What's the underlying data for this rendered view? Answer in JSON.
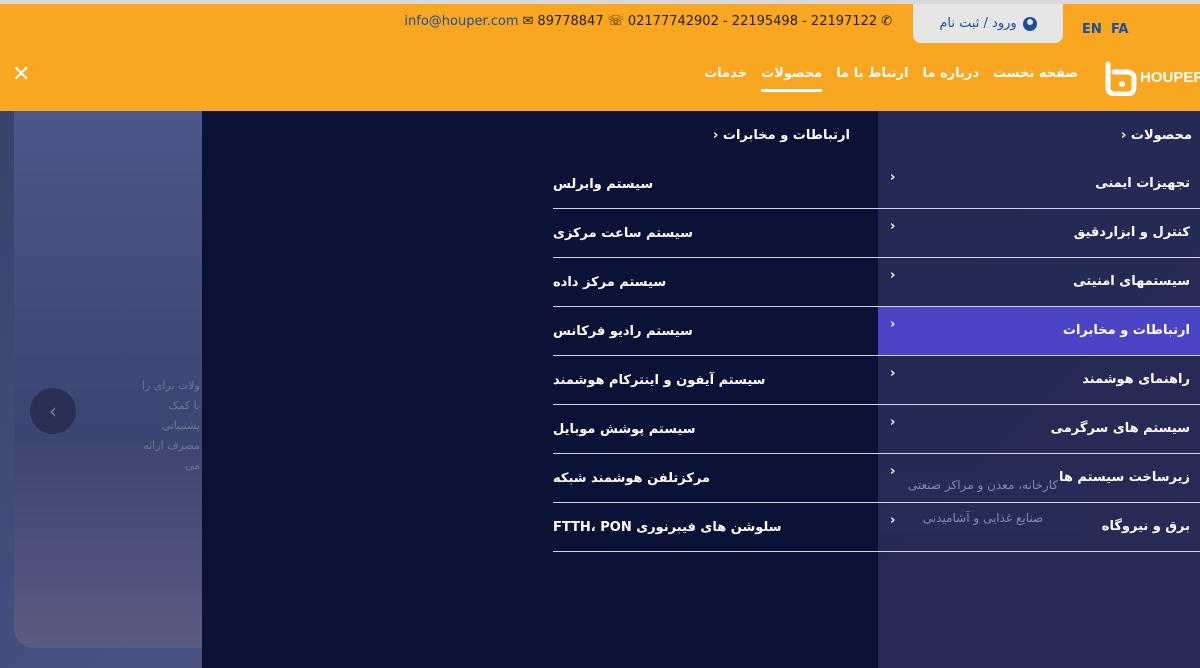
{
  "topbar": {
    "email": "info@houper.com",
    "fax": "89778847",
    "phones": "02177742902 - 22195498 - 22197122",
    "login_label": "ورود / ثبت نام",
    "lang_en": "EN",
    "lang_fa": "FA"
  },
  "nav": {
    "logo_text": "HOUPER",
    "items": [
      {
        "label": "صفحه نخست"
      },
      {
        "label": "درباره ما"
      },
      {
        "label": "ارتباط با ما"
      },
      {
        "label": "محصولات"
      },
      {
        "label": "خدمات"
      }
    ]
  },
  "background": {
    "text": "ولات برای را با کمک پشتیبانی مصرف ارائه می",
    "button_1": "کارخانه، معدن و مراکز صنعتی",
    "button_2": "صنایع غذایی و آشامیدنی"
  },
  "menu": {
    "root_title": "محصولات",
    "categories": [
      {
        "label": "تجهیزات ایمنی"
      },
      {
        "label": "کنترل و ابزاردقیق"
      },
      {
        "label": "سیستمهای امنیتی"
      },
      {
        "label": "ارتباطات و مخابرات"
      },
      {
        "label": "راهنمای هوشمند"
      },
      {
        "label": "سیستم های سرگرمی"
      },
      {
        "label": "زیرساخت سیستم ها"
      },
      {
        "label": "برق و نیروگاه"
      }
    ],
    "active_category_title": "ارتباطات و مخابرات",
    "subitems": [
      {
        "label": "سیستم وایرلس"
      },
      {
        "label": "سیستم ساعت مرکزی"
      },
      {
        "label": "سیستم مرکز داده"
      },
      {
        "label": "سیستم رادیو فرکانس"
      },
      {
        "label": "سیستم آیفون و اینترکام هوشمند"
      },
      {
        "label": "سیستم پوشش موبایل"
      },
      {
        "label": "مرکزتلفن هوشمند شبکه"
      },
      {
        "label": "سلوشن های فیبرنوری FTTH، PON"
      }
    ]
  }
}
